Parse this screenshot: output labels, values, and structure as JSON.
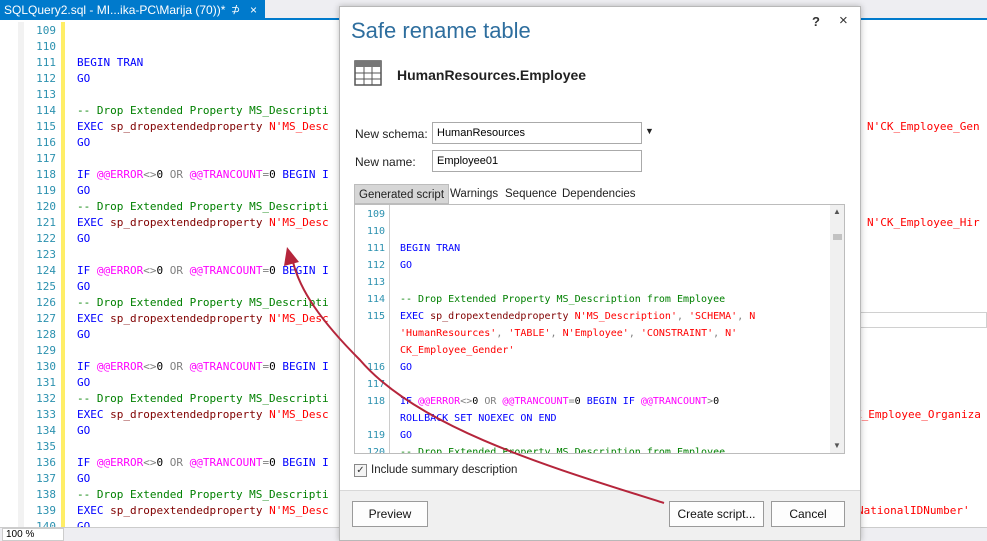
{
  "tab": {
    "title": "SQLQuery2.sql - MI...ika-PC\\Marija (70))*",
    "pin": "⊅",
    "close": "×"
  },
  "editor": {
    "lines": [
      {
        "n": "109",
        "parts": []
      },
      {
        "n": "110",
        "parts": []
      },
      {
        "n": "111",
        "parts": [
          {
            "c": "kw",
            "t": "BEGIN TRAN"
          }
        ]
      },
      {
        "n": "112",
        "parts": [
          {
            "c": "kw",
            "t": "GO"
          }
        ]
      },
      {
        "n": "113",
        "parts": []
      },
      {
        "n": "114",
        "parts": [
          {
            "c": "cm",
            "t": "-- Drop Extended Property MS_Descripti"
          }
        ]
      },
      {
        "n": "115",
        "parts": [
          {
            "c": "kw",
            "t": "EXEC "
          },
          {
            "c": "sp",
            "t": "sp_dropextendedproperty "
          },
          {
            "c": "st",
            "t": "N'MS_Desc"
          }
        ]
      },
      {
        "n": "116",
        "parts": [
          {
            "c": "kw",
            "t": "GO"
          }
        ]
      },
      {
        "n": "117",
        "parts": []
      },
      {
        "n": "118",
        "parts": [
          {
            "c": "kw",
            "t": "IF "
          },
          {
            "c": "mg",
            "t": "@@ERROR"
          },
          {
            "c": "gy",
            "t": "<>"
          },
          {
            "c": "",
            "t": "0 "
          },
          {
            "c": "gy",
            "t": "OR "
          },
          {
            "c": "mg",
            "t": "@@TRANCOUNT"
          },
          {
            "c": "gy",
            "t": "="
          },
          {
            "c": "",
            "t": "0 "
          },
          {
            "c": "kw",
            "t": "BEGIN I"
          }
        ]
      },
      {
        "n": "119",
        "parts": [
          {
            "c": "kw",
            "t": "GO"
          }
        ]
      },
      {
        "n": "120",
        "parts": [
          {
            "c": "cm",
            "t": "-- Drop Extended Property MS_Descripti"
          }
        ]
      },
      {
        "n": "121",
        "parts": [
          {
            "c": "kw",
            "t": "EXEC "
          },
          {
            "c": "sp",
            "t": "sp_dropextendedproperty "
          },
          {
            "c": "st",
            "t": "N'MS_Desc"
          }
        ]
      },
      {
        "n": "122",
        "parts": [
          {
            "c": "kw",
            "t": "GO"
          }
        ]
      },
      {
        "n": "123",
        "parts": []
      },
      {
        "n": "124",
        "parts": [
          {
            "c": "kw",
            "t": "IF "
          },
          {
            "c": "mg",
            "t": "@@ERROR"
          },
          {
            "c": "gy",
            "t": "<>"
          },
          {
            "c": "",
            "t": "0 "
          },
          {
            "c": "gy",
            "t": "OR "
          },
          {
            "c": "mg",
            "t": "@@TRANCOUNT"
          },
          {
            "c": "gy",
            "t": "="
          },
          {
            "c": "",
            "t": "0 "
          },
          {
            "c": "kw",
            "t": "BEGIN I"
          }
        ]
      },
      {
        "n": "125",
        "parts": [
          {
            "c": "kw",
            "t": "GO"
          }
        ]
      },
      {
        "n": "126",
        "parts": [
          {
            "c": "cm",
            "t": "-- Drop Extended Property MS_Descripti"
          }
        ]
      },
      {
        "n": "127",
        "parts": [
          {
            "c": "kw",
            "t": "EXEC "
          },
          {
            "c": "sp",
            "t": "sp_dropextendedproperty "
          },
          {
            "c": "st",
            "t": "N'MS_Desc"
          }
        ]
      },
      {
        "n": "128",
        "parts": [
          {
            "c": "kw",
            "t": "GO"
          }
        ]
      },
      {
        "n": "129",
        "parts": []
      },
      {
        "n": "130",
        "parts": [
          {
            "c": "kw",
            "t": "IF "
          },
          {
            "c": "mg",
            "t": "@@ERROR"
          },
          {
            "c": "gy",
            "t": "<>"
          },
          {
            "c": "",
            "t": "0 "
          },
          {
            "c": "gy",
            "t": "OR "
          },
          {
            "c": "mg",
            "t": "@@TRANCOUNT"
          },
          {
            "c": "gy",
            "t": "="
          },
          {
            "c": "",
            "t": "0 "
          },
          {
            "c": "kw",
            "t": "BEGIN I"
          }
        ]
      },
      {
        "n": "131",
        "parts": [
          {
            "c": "kw",
            "t": "GO"
          }
        ]
      },
      {
        "n": "132",
        "parts": [
          {
            "c": "cm",
            "t": "-- Drop Extended Property MS_Descripti"
          }
        ]
      },
      {
        "n": "133",
        "parts": [
          {
            "c": "kw",
            "t": "EXEC "
          },
          {
            "c": "sp",
            "t": "sp_dropextendedproperty "
          },
          {
            "c": "st",
            "t": "N'MS_Desc"
          }
        ]
      },
      {
        "n": "134",
        "parts": [
          {
            "c": "kw",
            "t": "GO"
          }
        ]
      },
      {
        "n": "135",
        "parts": []
      },
      {
        "n": "136",
        "parts": [
          {
            "c": "kw",
            "t": "IF "
          },
          {
            "c": "mg",
            "t": "@@ERROR"
          },
          {
            "c": "gy",
            "t": "<>"
          },
          {
            "c": "",
            "t": "0 "
          },
          {
            "c": "gy",
            "t": "OR "
          },
          {
            "c": "mg",
            "t": "@@TRANCOUNT"
          },
          {
            "c": "gy",
            "t": "="
          },
          {
            "c": "",
            "t": "0 "
          },
          {
            "c": "kw",
            "t": "BEGIN I"
          }
        ]
      },
      {
        "n": "137",
        "parts": [
          {
            "c": "kw",
            "t": "GO"
          }
        ]
      },
      {
        "n": "138",
        "parts": [
          {
            "c": "cm",
            "t": "-- Drop Extended Property MS_Descripti"
          }
        ]
      },
      {
        "n": "139",
        "parts": [
          {
            "c": "kw",
            "t": "EXEC "
          },
          {
            "c": "sp",
            "t": "sp_dropextendedproperty "
          },
          {
            "c": "st",
            "t": "N'MS_Desc"
          }
        ]
      },
      {
        "n": "140",
        "parts": [
          {
            "c": "kw",
            "t": "GO"
          }
        ]
      }
    ],
    "right_fragments": [
      {
        "line": "115",
        "text": "N'CK_Employee_Gen"
      },
      {
        "line": "121",
        "text": "N'CK_Employee_Hir"
      },
      {
        "line": "133",
        "text": "K_Employee_Organiza"
      },
      {
        "line": "139",
        "text": "NationalIDNumber'"
      }
    ]
  },
  "status": {
    "zoom": "100 %"
  },
  "dialog": {
    "title": "Safe rename table",
    "help": "?",
    "close": "×",
    "table_name": "HumanResources.Employee",
    "schema_label": "New schema:",
    "schema_value": "HumanResources",
    "name_label": "New name:",
    "name_value": "Employee01",
    "tabs": [
      "Generated script",
      "Warnings",
      "Sequence",
      "Dependencies"
    ],
    "script": [
      {
        "n": "109",
        "parts": []
      },
      {
        "n": "110",
        "parts": []
      },
      {
        "n": "111",
        "parts": [
          {
            "c": "kw",
            "t": "BEGIN TRAN"
          }
        ]
      },
      {
        "n": "112",
        "parts": [
          {
            "c": "kw",
            "t": "GO"
          }
        ]
      },
      {
        "n": "113",
        "parts": []
      },
      {
        "n": "114",
        "parts": [
          {
            "c": "cm",
            "t": "-- Drop Extended Property MS_Description from Employee"
          }
        ]
      },
      {
        "n": "115",
        "parts": [
          {
            "c": "kw",
            "t": "EXEC "
          },
          {
            "c": "sp",
            "t": "sp_dropextendedproperty "
          },
          {
            "c": "st",
            "t": "N'MS_Description'"
          },
          {
            "c": "gy",
            "t": ", "
          },
          {
            "c": "st",
            "t": "'SCHEMA'"
          },
          {
            "c": "gy",
            "t": ", "
          },
          {
            "c": "st",
            "t": "N"
          }
        ]
      },
      {
        "n": "",
        "parts": [
          {
            "c": "st",
            "t": "'HumanResources'"
          },
          {
            "c": "gy",
            "t": ", "
          },
          {
            "c": "st",
            "t": "'TABLE'"
          },
          {
            "c": "gy",
            "t": ", "
          },
          {
            "c": "st",
            "t": "N'Employee'"
          },
          {
            "c": "gy",
            "t": ", "
          },
          {
            "c": "st",
            "t": "'CONSTRAINT'"
          },
          {
            "c": "gy",
            "t": ", "
          },
          {
            "c": "st",
            "t": "N'"
          }
        ]
      },
      {
        "n": "",
        "parts": [
          {
            "c": "st",
            "t": "CK_Employee_Gender'"
          }
        ]
      },
      {
        "n": "116",
        "parts": [
          {
            "c": "kw",
            "t": "GO"
          }
        ]
      },
      {
        "n": "117",
        "parts": []
      },
      {
        "n": "118",
        "parts": [
          {
            "c": "kw",
            "t": "IF "
          },
          {
            "c": "mg",
            "t": "@@ERROR"
          },
          {
            "c": "gy",
            "t": "<>"
          },
          {
            "c": "",
            "t": "0 "
          },
          {
            "c": "gy",
            "t": "OR "
          },
          {
            "c": "mg",
            "t": "@@TRANCOUNT"
          },
          {
            "c": "gy",
            "t": "="
          },
          {
            "c": "",
            "t": "0 "
          },
          {
            "c": "kw",
            "t": "BEGIN IF "
          },
          {
            "c": "mg",
            "t": "@@TRANCOUNT"
          },
          {
            "c": "gy",
            "t": ">"
          },
          {
            "c": "",
            "t": "0"
          }
        ]
      },
      {
        "n": "",
        "parts": [
          {
            "c": "kw",
            "t": "ROLLBACK SET NOEXEC ON END"
          }
        ]
      },
      {
        "n": "119",
        "parts": [
          {
            "c": "kw",
            "t": "GO"
          }
        ]
      },
      {
        "n": "120",
        "parts": [
          {
            "c": "cm",
            "t": "-- Drop Extended Property MS_Description from Employee"
          }
        ]
      }
    ],
    "include_summary_label": "Include summary description",
    "include_summary_checked": "✓",
    "preview_label": "Preview",
    "create_script_label": "Create script...",
    "cancel_label": "Cancel"
  },
  "colors": {
    "accent": "#007acc",
    "title": "#2e6e9e",
    "arrow": "#b5253b"
  }
}
